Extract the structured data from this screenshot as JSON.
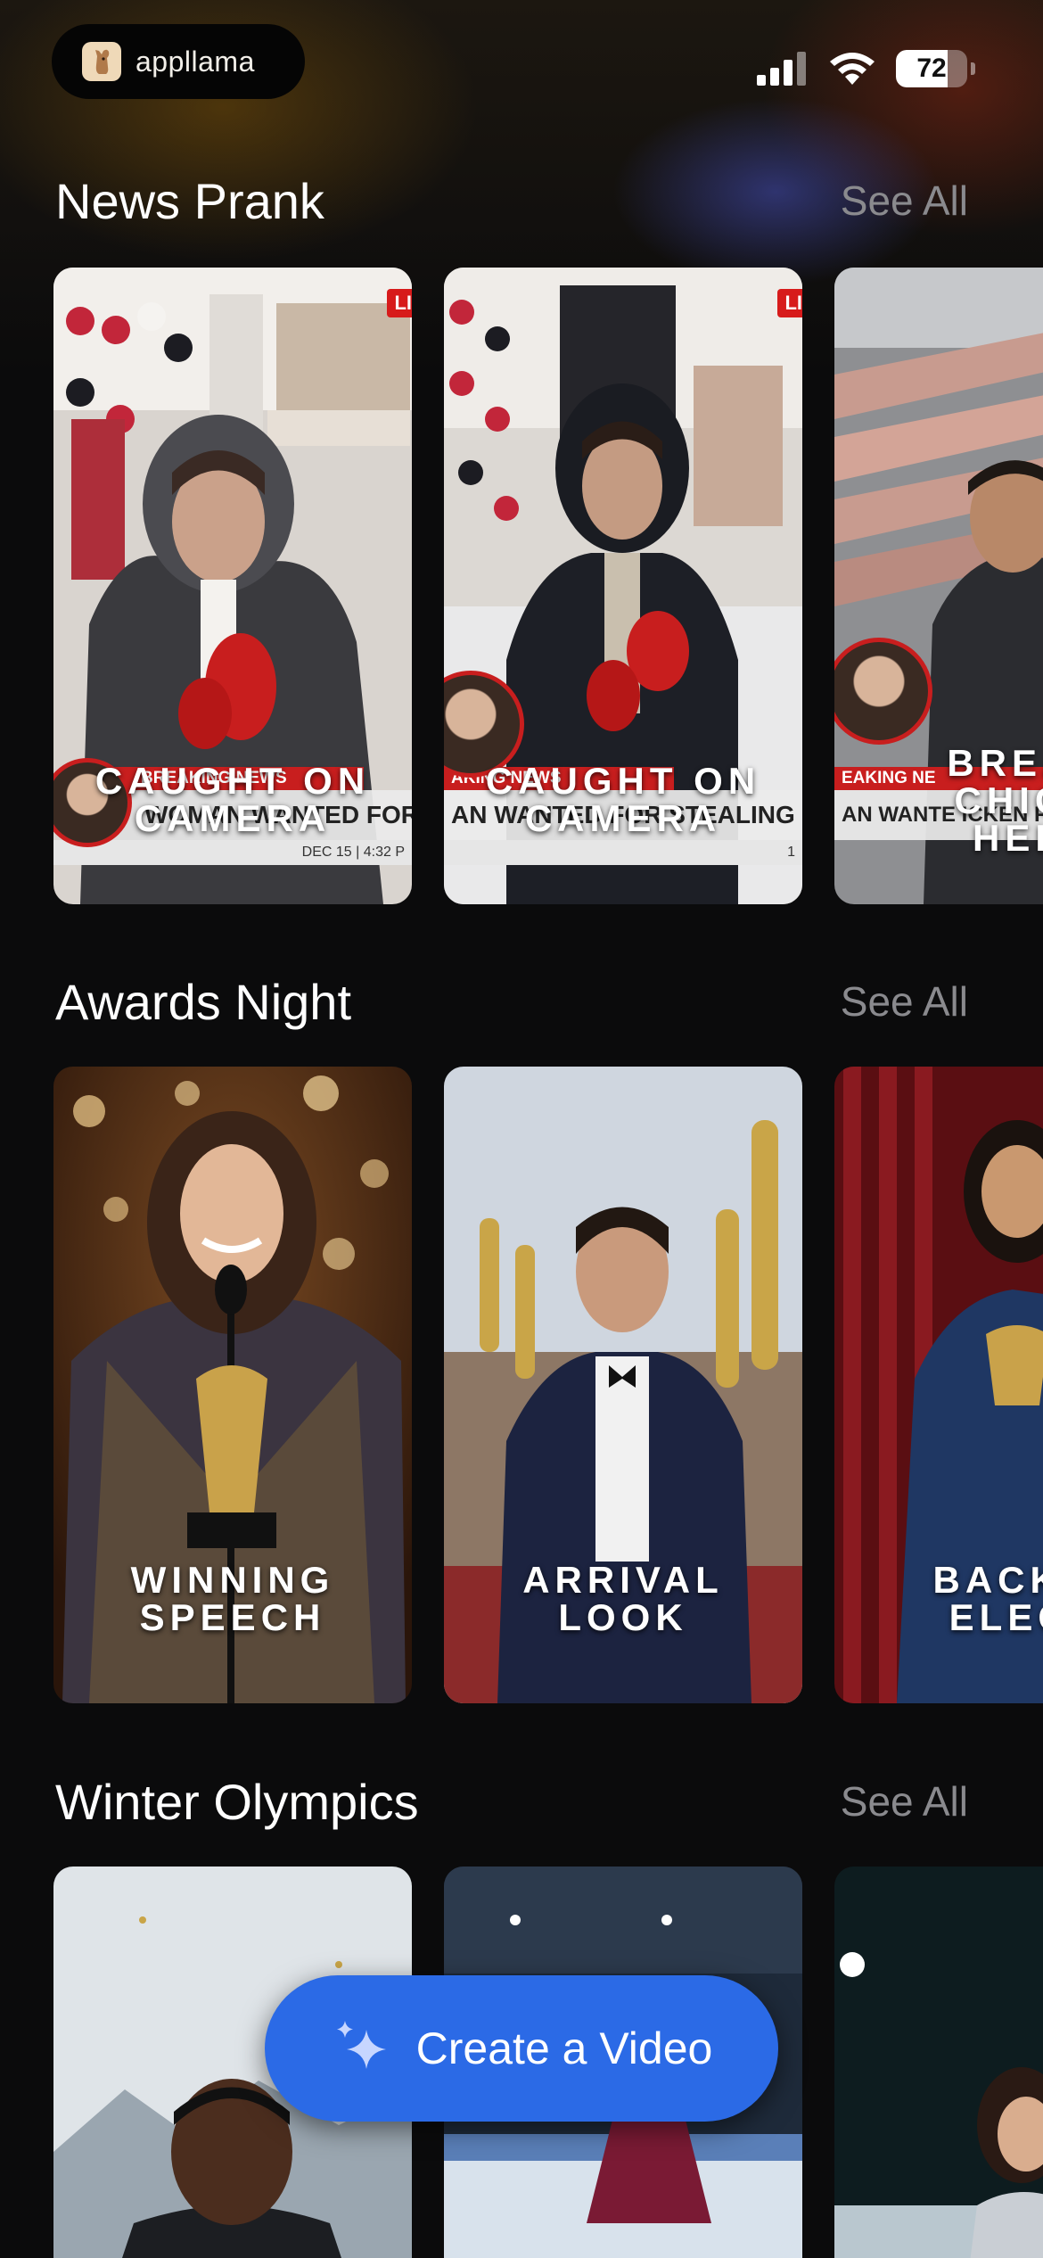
{
  "status_bar": {
    "app_badge": "appllama",
    "battery_level": 72,
    "battery_text": "72",
    "signal_bars": 4,
    "wifi": true
  },
  "sections": [
    {
      "title": "News Prank",
      "see_all": "See All",
      "cards": [
        {
          "title": "CAUGHT ON\nCAMERA",
          "badge": "LI",
          "ticker_tag": "BREAKING NEWS",
          "ticker_text": "WOMAN WANTED FOR",
          "ticker_date": "DEC 15 | 4:32 P"
        },
        {
          "title": "CAUGHT ON\nCAMERA",
          "badge": "LI",
          "ticker_tag": "AKING NEWS",
          "ticker_text": "AN WANTED FOR STEALING B",
          "ticker_date": "1"
        },
        {
          "title": "BREAK\nCHICK\nHEIS",
          "badge": "",
          "ticker_tag": "EAKING NE",
          "ticker_text": "AN WANTE\nICKEN FROM STO",
          "ticker_date": ""
        }
      ]
    },
    {
      "title": "Awards Night",
      "see_all": "See All",
      "cards": [
        {
          "title": "WINNING\nSPEECH"
        },
        {
          "title": "ARRIVAL\nLOOK"
        },
        {
          "title": "BACKST\nELEGA"
        }
      ]
    },
    {
      "title": "Winter Olympics",
      "see_all": "See All",
      "cards": [
        {
          "title": ""
        },
        {
          "title": ""
        },
        {
          "title": ""
        }
      ]
    }
  ],
  "create_button": {
    "label": "Create a Video",
    "icon": "sparkles-icon"
  },
  "colors": {
    "accent": "#2b6ae6",
    "background": "#0b0b0c",
    "muted_text": "#8a8a8e"
  }
}
